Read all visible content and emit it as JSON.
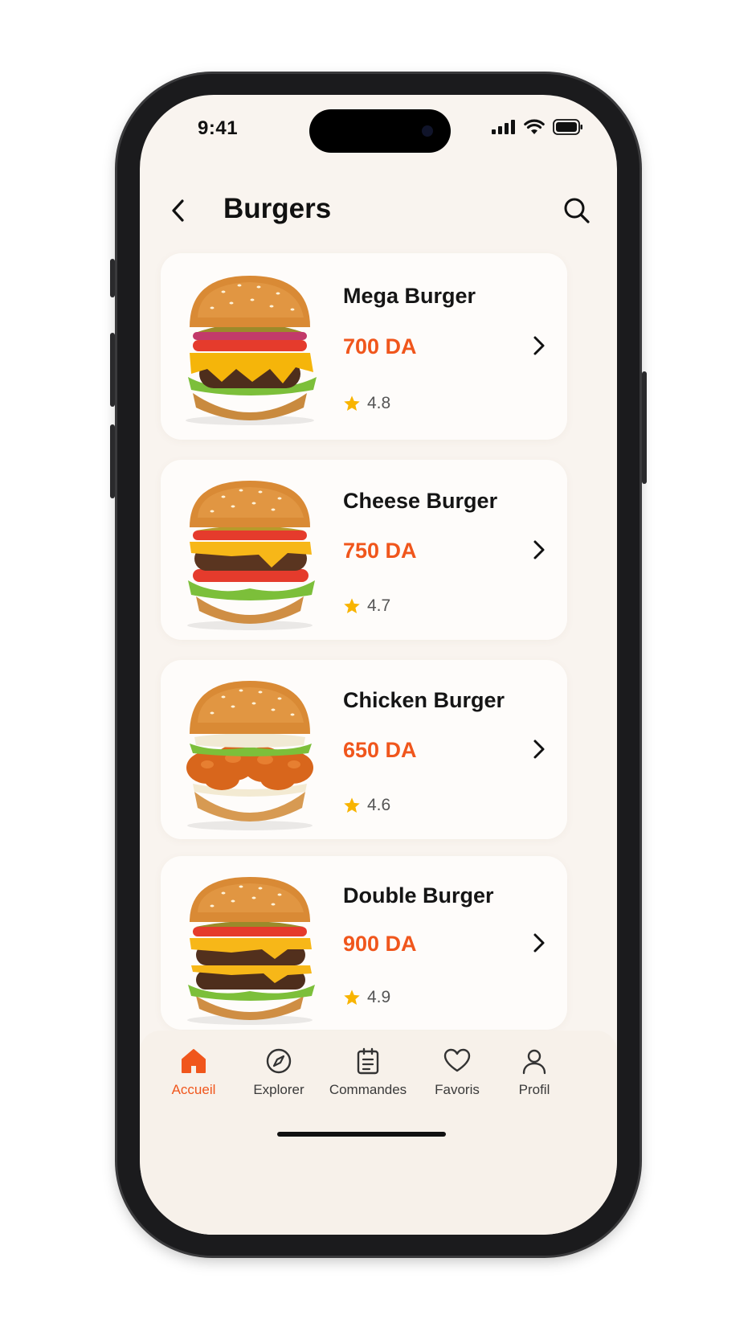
{
  "status_bar": {
    "time": "9:41"
  },
  "header": {
    "title": "Burgers"
  },
  "products": [
    {
      "name": "Mega Burger",
      "price": "700 DA",
      "rating": "4.8"
    },
    {
      "name": "Cheese Burger",
      "price": "750 DA",
      "rating": "4.7"
    },
    {
      "name": "Chicken Burger",
      "price": "650 DA",
      "rating": "4.6"
    },
    {
      "name": "Double Burger",
      "price": "900 DA",
      "rating": "4.9"
    }
  ],
  "tabs": [
    {
      "label": "Accueil",
      "icon": "home-icon",
      "active": true
    },
    {
      "label": "Explorer",
      "icon": "compass-icon",
      "active": false
    },
    {
      "label": "Commandes",
      "icon": "clipboard-icon",
      "active": false
    },
    {
      "label": "Favoris",
      "icon": "heart-icon",
      "active": false
    },
    {
      "label": "Profil",
      "icon": "user-icon",
      "active": false
    }
  ],
  "colors": {
    "accent": "#f0561c",
    "background": "#f9f4ef",
    "card": "#fefcfa",
    "star": "#f8b400"
  }
}
